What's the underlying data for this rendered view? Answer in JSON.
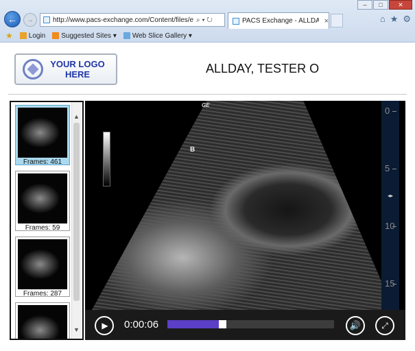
{
  "browser": {
    "address_url": "http://www.pacs-exchange.com/Content/files/enterta",
    "address_controls": "⌕ ▾ ↻",
    "tab_title": "PACS Exchange - ALLDAY, ...",
    "tab_close": "×",
    "back_icon": "←",
    "forward_icon": "→",
    "window_buttons": [
      "–",
      "□",
      "✕"
    ],
    "toolbar_icons": [
      "⌂",
      "★",
      "⚙"
    ],
    "favorites_bar": {
      "star": "★",
      "items": [
        {
          "label": "Login"
        },
        {
          "label": "Suggested Sites ▾"
        },
        {
          "label": "Web Slice Gallery ▾"
        }
      ]
    }
  },
  "page": {
    "logo_text": "YOUR LOGO HERE",
    "patient_name": "ALLDAY, TESTER O"
  },
  "thumbnails": [
    {
      "caption": "Frames: 461",
      "selected": true
    },
    {
      "caption": "Frames: 59",
      "selected": false
    },
    {
      "caption": "Frames: 287",
      "selected": false
    },
    {
      "caption": "",
      "selected": false
    }
  ],
  "scrollbar": {
    "up": "▲",
    "down": "▼"
  },
  "viewer": {
    "vendor": "GE",
    "marker": "B",
    "side_marker": "◂▸",
    "depth_ticks": [
      "0",
      "5",
      "10",
      "15"
    ]
  },
  "player": {
    "play_icon": "▶",
    "time": "0:00:06",
    "progress": 0.31,
    "volume_icon": "🔊",
    "fullscreen_icon": "⤢"
  }
}
